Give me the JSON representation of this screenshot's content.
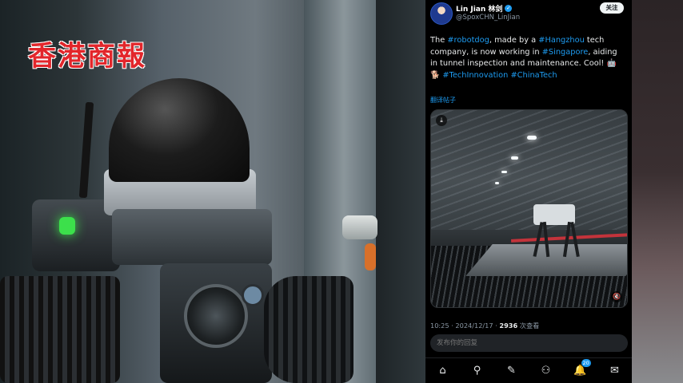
{
  "watermark": {
    "logo_text": "香港商報"
  },
  "tweet": {
    "author": {
      "display_name": "Lin Jian 林剑",
      "handle": "@SpoxCHN_LinJian"
    },
    "follow_label": "关注",
    "text_parts": [
      {
        "t": "The "
      },
      {
        "t": "#robotdog",
        "tag": true
      },
      {
        "t": ", made by a "
      },
      {
        "t": "#Hangzhou",
        "tag": true
      },
      {
        "t": " tech company, is now working in "
      },
      {
        "t": "#Singapore",
        "tag": true
      },
      {
        "t": ", aiding in tunnel inspection and maintenance. Cool! 🤖 🐕 "
      },
      {
        "t": "#TechInnovation",
        "tag": true
      },
      {
        "t": " "
      },
      {
        "t": "#ChinaTech",
        "tag": true
      }
    ],
    "translate_label": "翻译帖子",
    "meta": {
      "time_date": "10:25 · 2024/12/17 · ",
      "views": "2936",
      "views_label": " 次查看"
    },
    "reply_placeholder": "发布你的回复"
  },
  "bottom_nav": {
    "notification_badge": "20",
    "icons": [
      "home-icon",
      "search-icon",
      "compose-icon",
      "communities-icon",
      "notifications-icon",
      "messages-icon"
    ]
  },
  "colors": {
    "accent": "#1d9bf0",
    "logo_red": "#e2262b",
    "led_green": "#3ce04b"
  }
}
